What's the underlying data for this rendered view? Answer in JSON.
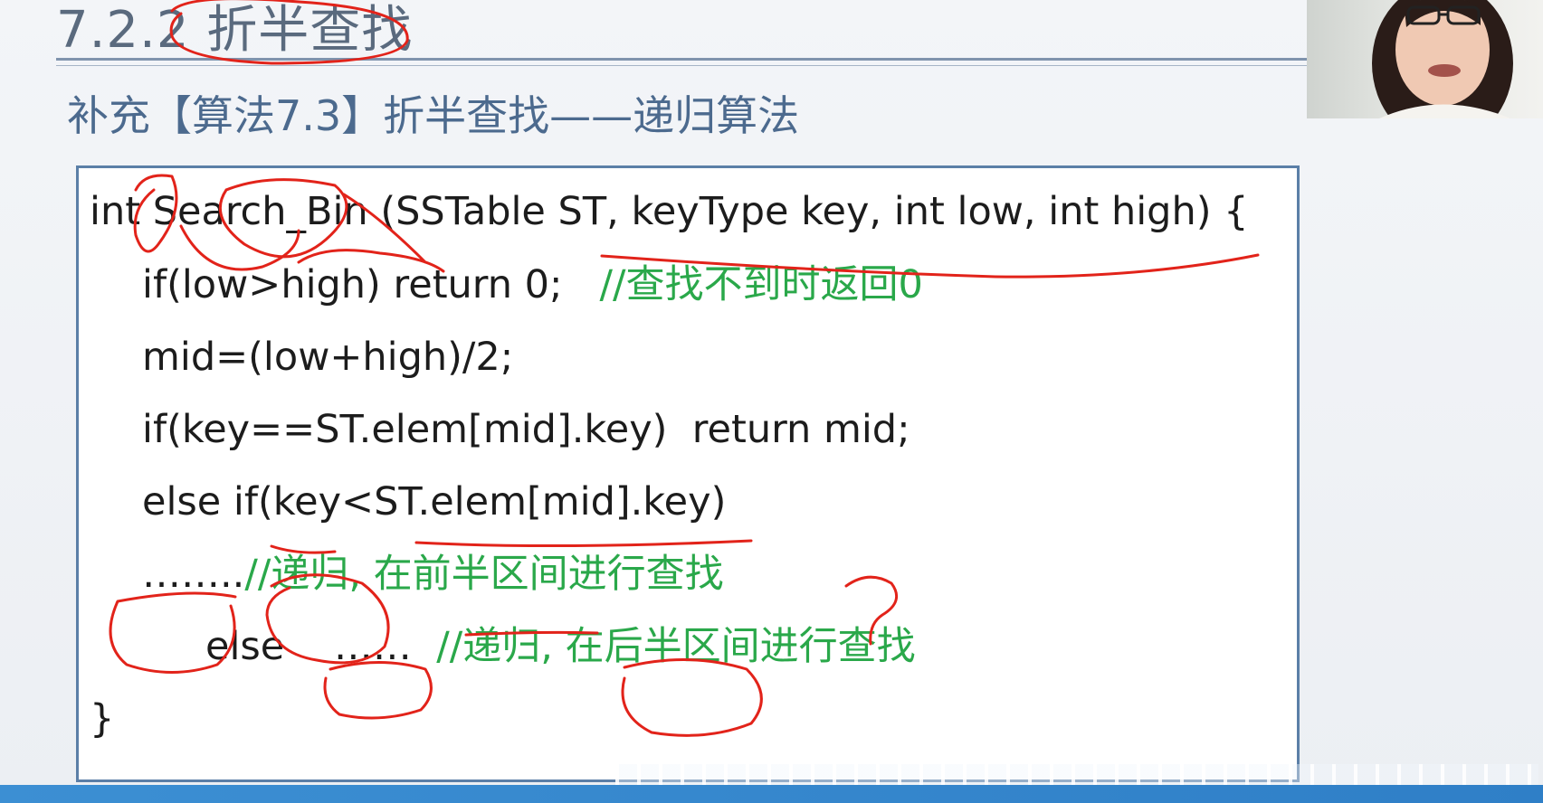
{
  "slide": {
    "section_title": "7.2.2 折半查找",
    "subtitle": "补充【算法7.3】折半查找——递归算法"
  },
  "code": {
    "line1": "int Search_Bin (SSTable ST, keyType key, int low, int high) {",
    "line2_code": "if(low>high) return 0;   ",
    "line2_comment": "//查找不到时返回0",
    "line3": "mid=(low+high)/2;",
    "line4": "if(key==ST.elem[mid].key)  return mid;",
    "line5": "else if(key<ST.elem[mid].key)",
    "line6_code": "……..",
    "line6_comment": "//递归, 在前半区间进行查找",
    "line7_code": "else    ……  ",
    "line7_comment": "//递归, 在后半区间进行查找",
    "line8": "}"
  },
  "annotations": {
    "ink_color": "#e2231a"
  }
}
